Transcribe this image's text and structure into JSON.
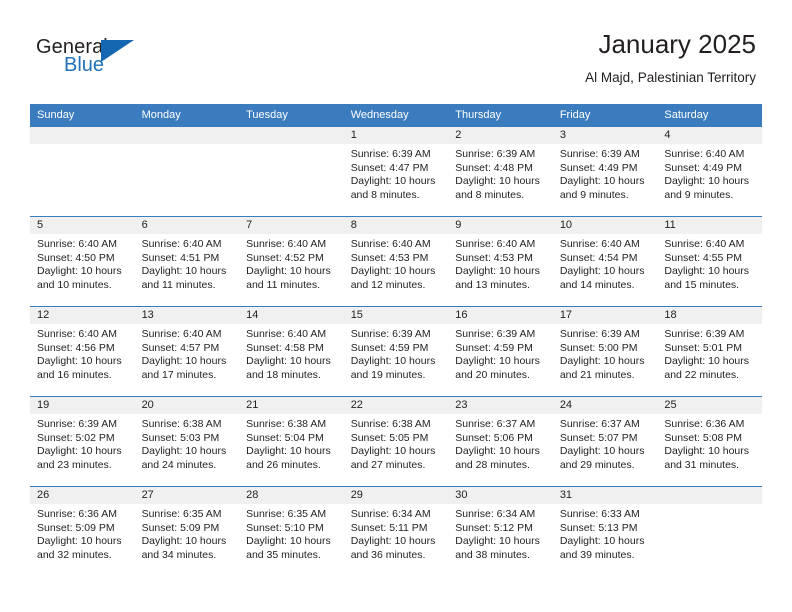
{
  "brand": {
    "word_general": "General",
    "word_blue": "Blue",
    "accent_color": "#1667b1"
  },
  "header": {
    "title": "January 2025",
    "subtitle": "Al Majd, Palestinian Territory"
  },
  "theme": {
    "header_row_bg": "#3a7cbe",
    "daynum_band_bg": "#f0f0f0",
    "text_color": "#231f20"
  },
  "weekday_headers": [
    "Sunday",
    "Monday",
    "Tuesday",
    "Wednesday",
    "Thursday",
    "Friday",
    "Saturday"
  ],
  "weeks": [
    [
      {
        "day": "",
        "empty": true
      },
      {
        "day": "",
        "empty": true
      },
      {
        "day": "",
        "empty": true
      },
      {
        "day": "1",
        "sunrise": "Sunrise: 6:39 AM",
        "sunset": "Sunset: 4:47 PM",
        "daylight_line1": "Daylight: 10 hours",
        "daylight_line2": "and 8 minutes."
      },
      {
        "day": "2",
        "sunrise": "Sunrise: 6:39 AM",
        "sunset": "Sunset: 4:48 PM",
        "daylight_line1": "Daylight: 10 hours",
        "daylight_line2": "and 8 minutes."
      },
      {
        "day": "3",
        "sunrise": "Sunrise: 6:39 AM",
        "sunset": "Sunset: 4:49 PM",
        "daylight_line1": "Daylight: 10 hours",
        "daylight_line2": "and 9 minutes."
      },
      {
        "day": "4",
        "sunrise": "Sunrise: 6:40 AM",
        "sunset": "Sunset: 4:49 PM",
        "daylight_line1": "Daylight: 10 hours",
        "daylight_line2": "and 9 minutes."
      }
    ],
    [
      {
        "day": "5",
        "sunrise": "Sunrise: 6:40 AM",
        "sunset": "Sunset: 4:50 PM",
        "daylight_line1": "Daylight: 10 hours",
        "daylight_line2": "and 10 minutes."
      },
      {
        "day": "6",
        "sunrise": "Sunrise: 6:40 AM",
        "sunset": "Sunset: 4:51 PM",
        "daylight_line1": "Daylight: 10 hours",
        "daylight_line2": "and 11 minutes."
      },
      {
        "day": "7",
        "sunrise": "Sunrise: 6:40 AM",
        "sunset": "Sunset: 4:52 PM",
        "daylight_line1": "Daylight: 10 hours",
        "daylight_line2": "and 11 minutes."
      },
      {
        "day": "8",
        "sunrise": "Sunrise: 6:40 AM",
        "sunset": "Sunset: 4:53 PM",
        "daylight_line1": "Daylight: 10 hours",
        "daylight_line2": "and 12 minutes."
      },
      {
        "day": "9",
        "sunrise": "Sunrise: 6:40 AM",
        "sunset": "Sunset: 4:53 PM",
        "daylight_line1": "Daylight: 10 hours",
        "daylight_line2": "and 13 minutes."
      },
      {
        "day": "10",
        "sunrise": "Sunrise: 6:40 AM",
        "sunset": "Sunset: 4:54 PM",
        "daylight_line1": "Daylight: 10 hours",
        "daylight_line2": "and 14 minutes."
      },
      {
        "day": "11",
        "sunrise": "Sunrise: 6:40 AM",
        "sunset": "Sunset: 4:55 PM",
        "daylight_line1": "Daylight: 10 hours",
        "daylight_line2": "and 15 minutes."
      }
    ],
    [
      {
        "day": "12",
        "sunrise": "Sunrise: 6:40 AM",
        "sunset": "Sunset: 4:56 PM",
        "daylight_line1": "Daylight: 10 hours",
        "daylight_line2": "and 16 minutes."
      },
      {
        "day": "13",
        "sunrise": "Sunrise: 6:40 AM",
        "sunset": "Sunset: 4:57 PM",
        "daylight_line1": "Daylight: 10 hours",
        "daylight_line2": "and 17 minutes."
      },
      {
        "day": "14",
        "sunrise": "Sunrise: 6:40 AM",
        "sunset": "Sunset: 4:58 PM",
        "daylight_line1": "Daylight: 10 hours",
        "daylight_line2": "and 18 minutes."
      },
      {
        "day": "15",
        "sunrise": "Sunrise: 6:39 AM",
        "sunset": "Sunset: 4:59 PM",
        "daylight_line1": "Daylight: 10 hours",
        "daylight_line2": "and 19 minutes."
      },
      {
        "day": "16",
        "sunrise": "Sunrise: 6:39 AM",
        "sunset": "Sunset: 4:59 PM",
        "daylight_line1": "Daylight: 10 hours",
        "daylight_line2": "and 20 minutes."
      },
      {
        "day": "17",
        "sunrise": "Sunrise: 6:39 AM",
        "sunset": "Sunset: 5:00 PM",
        "daylight_line1": "Daylight: 10 hours",
        "daylight_line2": "and 21 minutes."
      },
      {
        "day": "18",
        "sunrise": "Sunrise: 6:39 AM",
        "sunset": "Sunset: 5:01 PM",
        "daylight_line1": "Daylight: 10 hours",
        "daylight_line2": "and 22 minutes."
      }
    ],
    [
      {
        "day": "19",
        "sunrise": "Sunrise: 6:39 AM",
        "sunset": "Sunset: 5:02 PM",
        "daylight_line1": "Daylight: 10 hours",
        "daylight_line2": "and 23 minutes."
      },
      {
        "day": "20",
        "sunrise": "Sunrise: 6:38 AM",
        "sunset": "Sunset: 5:03 PM",
        "daylight_line1": "Daylight: 10 hours",
        "daylight_line2": "and 24 minutes."
      },
      {
        "day": "21",
        "sunrise": "Sunrise: 6:38 AM",
        "sunset": "Sunset: 5:04 PM",
        "daylight_line1": "Daylight: 10 hours",
        "daylight_line2": "and 26 minutes."
      },
      {
        "day": "22",
        "sunrise": "Sunrise: 6:38 AM",
        "sunset": "Sunset: 5:05 PM",
        "daylight_line1": "Daylight: 10 hours",
        "daylight_line2": "and 27 minutes."
      },
      {
        "day": "23",
        "sunrise": "Sunrise: 6:37 AM",
        "sunset": "Sunset: 5:06 PM",
        "daylight_line1": "Daylight: 10 hours",
        "daylight_line2": "and 28 minutes."
      },
      {
        "day": "24",
        "sunrise": "Sunrise: 6:37 AM",
        "sunset": "Sunset: 5:07 PM",
        "daylight_line1": "Daylight: 10 hours",
        "daylight_line2": "and 29 minutes."
      },
      {
        "day": "25",
        "sunrise": "Sunrise: 6:36 AM",
        "sunset": "Sunset: 5:08 PM",
        "daylight_line1": "Daylight: 10 hours",
        "daylight_line2": "and 31 minutes."
      }
    ],
    [
      {
        "day": "26",
        "sunrise": "Sunrise: 6:36 AM",
        "sunset": "Sunset: 5:09 PM",
        "daylight_line1": "Daylight: 10 hours",
        "daylight_line2": "and 32 minutes."
      },
      {
        "day": "27",
        "sunrise": "Sunrise: 6:35 AM",
        "sunset": "Sunset: 5:09 PM",
        "daylight_line1": "Daylight: 10 hours",
        "daylight_line2": "and 34 minutes."
      },
      {
        "day": "28",
        "sunrise": "Sunrise: 6:35 AM",
        "sunset": "Sunset: 5:10 PM",
        "daylight_line1": "Daylight: 10 hours",
        "daylight_line2": "and 35 minutes."
      },
      {
        "day": "29",
        "sunrise": "Sunrise: 6:34 AM",
        "sunset": "Sunset: 5:11 PM",
        "daylight_line1": "Daylight: 10 hours",
        "daylight_line2": "and 36 minutes."
      },
      {
        "day": "30",
        "sunrise": "Sunrise: 6:34 AM",
        "sunset": "Sunset: 5:12 PM",
        "daylight_line1": "Daylight: 10 hours",
        "daylight_line2": "and 38 minutes."
      },
      {
        "day": "31",
        "sunrise": "Sunrise: 6:33 AM",
        "sunset": "Sunset: 5:13 PM",
        "daylight_line1": "Daylight: 10 hours",
        "daylight_line2": "and 39 minutes."
      },
      {
        "day": "",
        "empty": true
      }
    ]
  ]
}
